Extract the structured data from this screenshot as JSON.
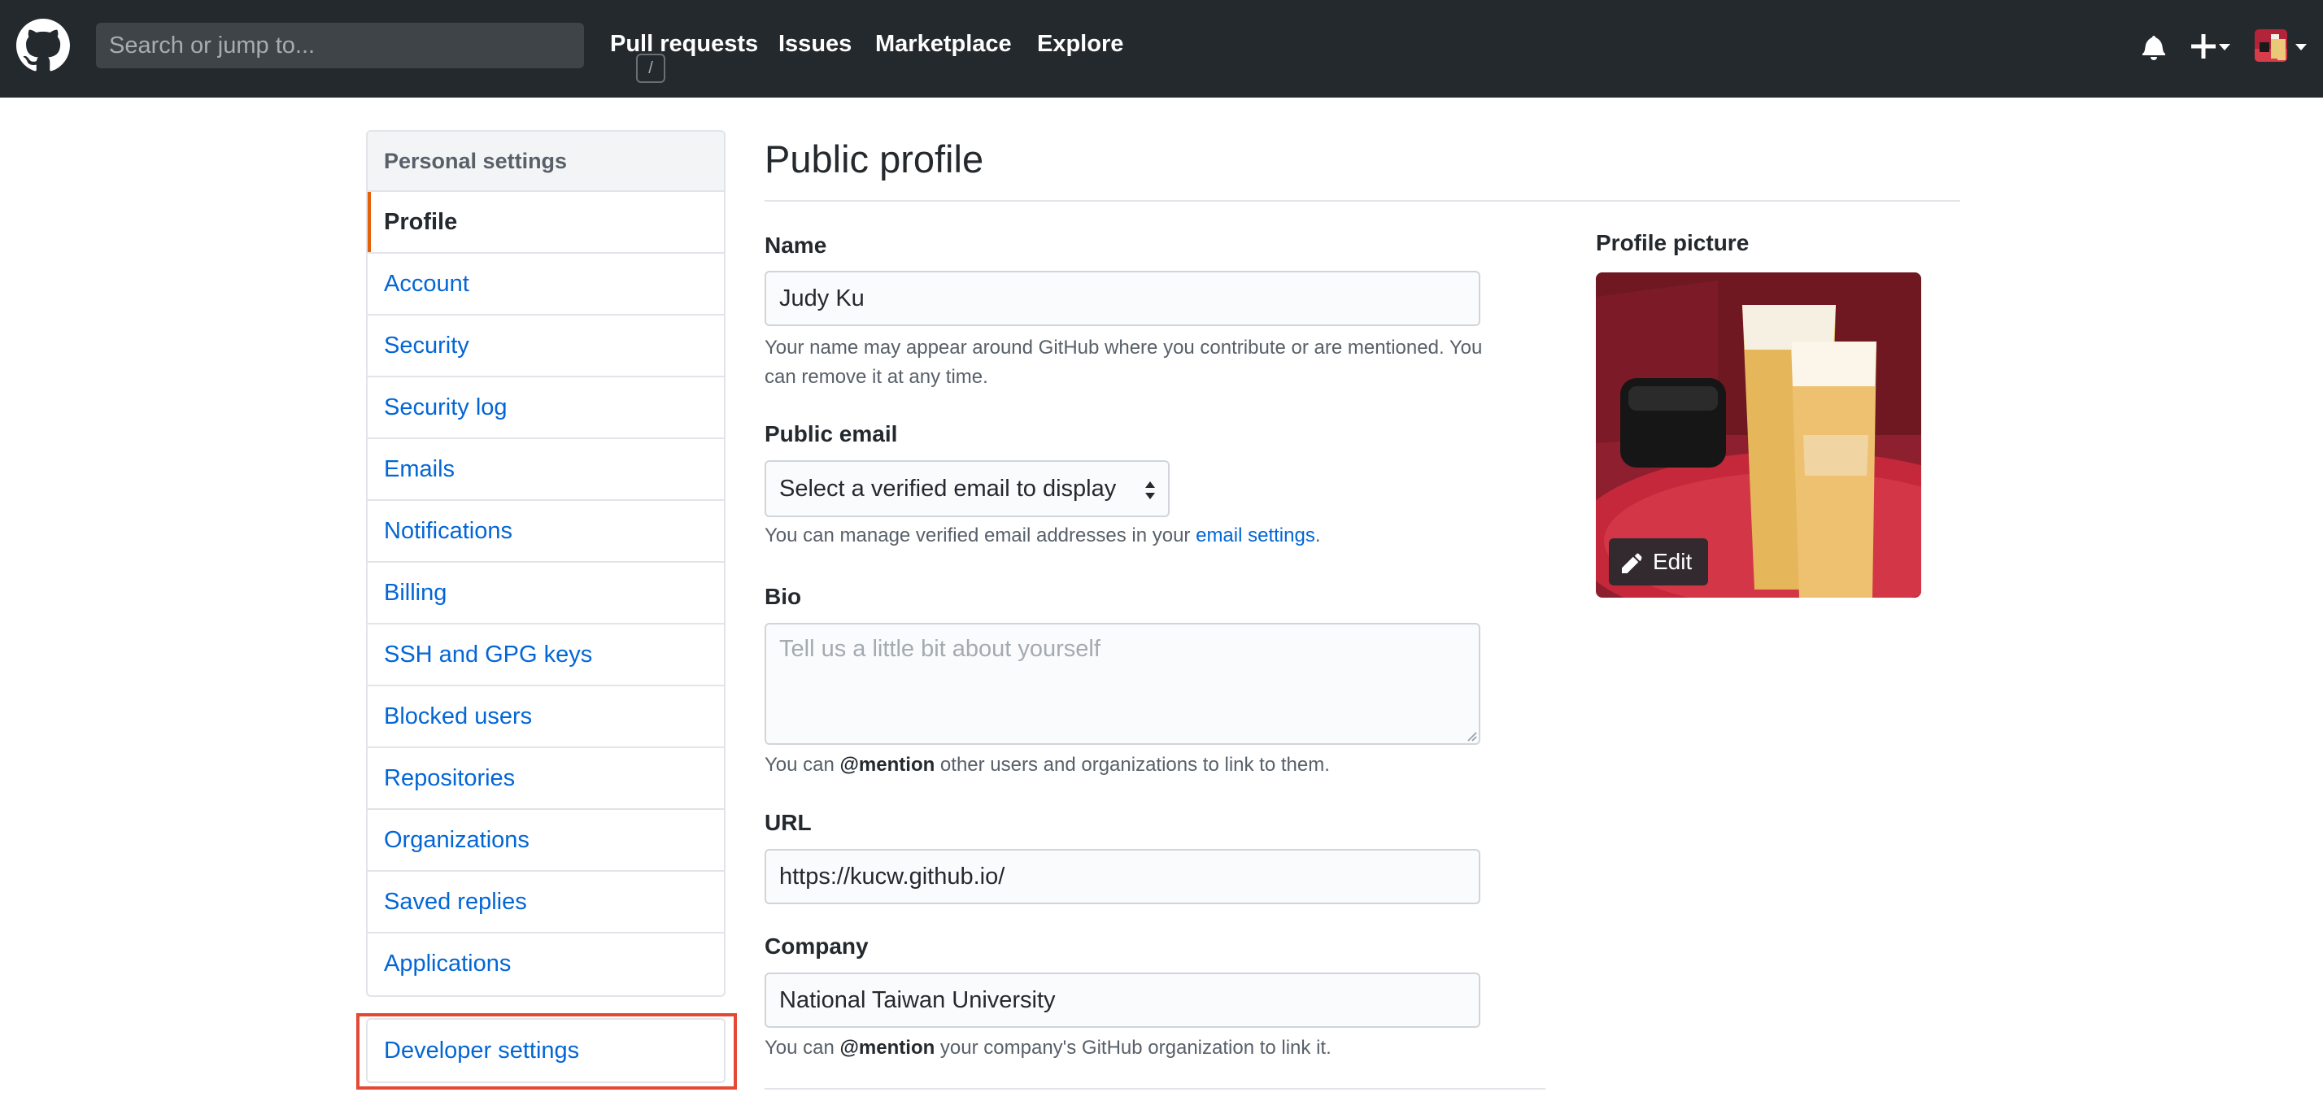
{
  "header": {
    "search_placeholder": "Search or jump to...",
    "search_shortcut": "/",
    "nav": [
      "Pull requests",
      "Issues",
      "Marketplace",
      "Explore"
    ]
  },
  "sidebar": {
    "heading": "Personal settings",
    "items": [
      {
        "label": "Profile",
        "selected": true
      },
      {
        "label": "Account"
      },
      {
        "label": "Security"
      },
      {
        "label": "Security log"
      },
      {
        "label": "Emails"
      },
      {
        "label": "Notifications"
      },
      {
        "label": "Billing"
      },
      {
        "label": "SSH and GPG keys"
      },
      {
        "label": "Blocked users"
      },
      {
        "label": "Repositories"
      },
      {
        "label": "Organizations"
      },
      {
        "label": "Saved replies"
      },
      {
        "label": "Applications"
      }
    ],
    "developer_settings": "Developer settings"
  },
  "main": {
    "title": "Public profile",
    "name_label": "Name",
    "name_value": "Judy Ku",
    "name_note_1": "Your name may appear around GitHub where you contribute or are mentioned. You",
    "name_note_2": "can remove it at any time.",
    "email_label": "Public email",
    "email_select": "Select a verified email to display",
    "email_note_pre": "You can manage verified email addresses in your ",
    "email_note_link": "email settings",
    "email_note_post": ".",
    "bio_label": "Bio",
    "bio_placeholder": "Tell us a little bit about yourself",
    "bio_note_pre": "You can ",
    "bio_note_mention": "@mention",
    "bio_note_post": " other users and organizations to link to them.",
    "url_label": "URL",
    "url_value": "https://kucw.github.io/",
    "company_label": "Company",
    "company_value": "National Taiwan University",
    "company_note_pre": "You can ",
    "company_note_mention": "@mention",
    "company_note_post": " your company's GitHub organization to link it."
  },
  "profile_picture": {
    "label": "Profile picture",
    "edit_label": "Edit"
  },
  "colors": {
    "header_bg": "#24292e",
    "link": "#0366d6",
    "selected_indicator": "#e36209",
    "highlight_outline": "#e34935"
  }
}
